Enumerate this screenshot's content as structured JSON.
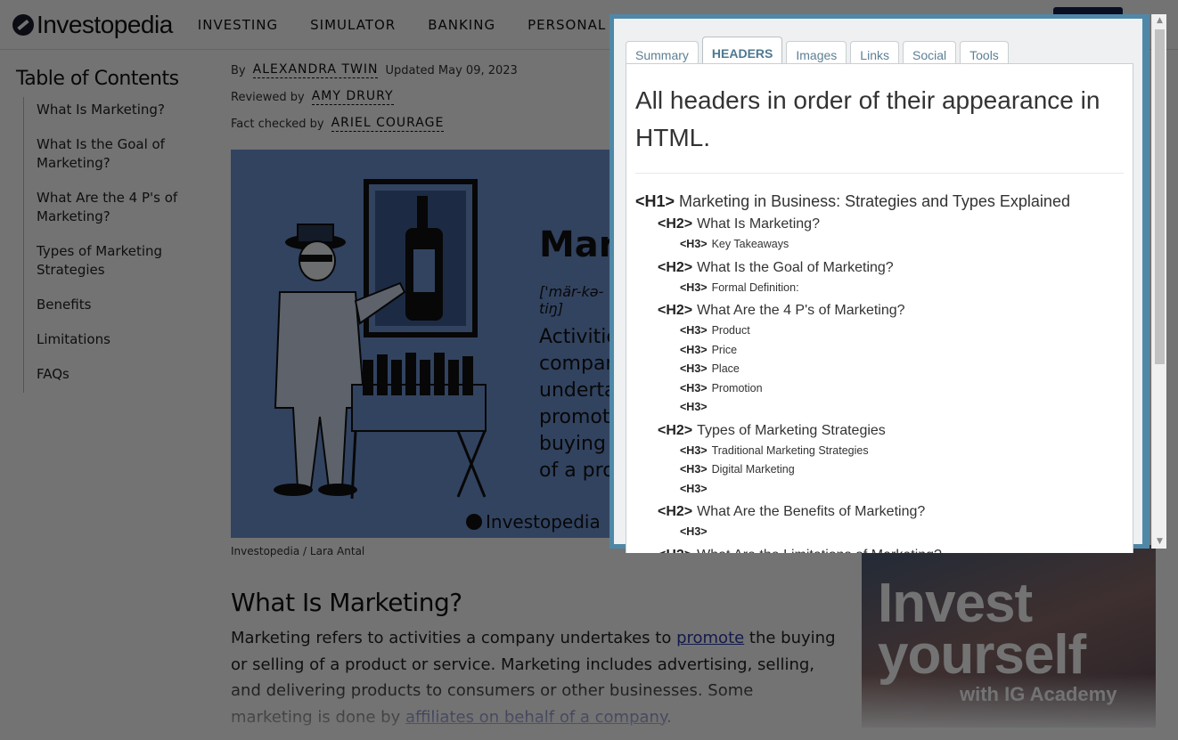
{
  "site": {
    "logo_text": "Investopedia",
    "nav": [
      "INVESTING",
      "SIMULATOR",
      "BANKING",
      "PERSONAL FINANCE"
    ]
  },
  "toc": {
    "title": "Table of Contents",
    "items": [
      "What Is Marketing?",
      "What Is the Goal of Marketing?",
      "What Are the 4 P's of Marketing?",
      "Types of Marketing Strategies",
      "Benefits",
      "Limitations",
      "FAQs"
    ]
  },
  "byline": {
    "by_label": "By",
    "author": "ALEXANDRA TWIN",
    "updated": "Updated May 09, 2023",
    "reviewed_label": "Reviewed by",
    "reviewer": "AMY DRURY",
    "factcheck_label": "Fact checked by",
    "factchecker": "ARIEL COURAGE"
  },
  "hero": {
    "title": "Marketing",
    "pronunciation": "['mär-kə-tiŋ]",
    "definition": "Activities a company undertakes to promote the buying or selling of a product",
    "brand": "Investopedia",
    "caption": "Investopedia / Lara Antal",
    "bg_color": "#6f95d6"
  },
  "article": {
    "heading": "What Is Marketing?",
    "p_before_link": "Marketing refers to activities a company undertakes to ",
    "link1": "promote",
    "p_after_link": " the buying or selling of a product or service. Marketing includes advertising, selling, and delivering products to consumers or other businesses. Some marketing is done by ",
    "link2": "affiliates on behalf of a company",
    "p_end": "."
  },
  "ad": {
    "line1": "Invest",
    "line2": "yourself",
    "line3": "with IG Academy"
  },
  "popup": {
    "tabs": [
      {
        "label": "Summary",
        "active": false
      },
      {
        "label": "HEADERS",
        "active": true
      },
      {
        "label": "Images",
        "active": false
      },
      {
        "label": "Links",
        "active": false
      },
      {
        "label": "Social",
        "active": false
      },
      {
        "label": "Tools",
        "active": false
      }
    ],
    "title": "All headers in order of their appearance in HTML.",
    "headers": [
      {
        "level": 1,
        "tag": "<H1>",
        "text": "Marketing in Business: Strategies and Types Explained"
      },
      {
        "level": 2,
        "tag": "<H2>",
        "text": "What Is Marketing?"
      },
      {
        "level": 3,
        "tag": "<H3>",
        "text": "Key Takeaways"
      },
      {
        "level": 2,
        "tag": "<H2>",
        "text": "What Is the Goal of Marketing?"
      },
      {
        "level": 3,
        "tag": "<H3>",
        "text": "Formal Definition:"
      },
      {
        "level": 2,
        "tag": "<H2>",
        "text": "What Are the 4 P's of Marketing?"
      },
      {
        "level": 3,
        "tag": "<H3>",
        "text": "Product"
      },
      {
        "level": 3,
        "tag": "<H3>",
        "text": "Price"
      },
      {
        "level": 3,
        "tag": "<H3>",
        "text": "Place"
      },
      {
        "level": 3,
        "tag": "<H3>",
        "text": "Promotion"
      },
      {
        "level": 3,
        "tag": "<H3>",
        "text": ""
      },
      {
        "level": 2,
        "tag": "<H2>",
        "text": "Types of Marketing Strategies"
      },
      {
        "level": 3,
        "tag": "<H3>",
        "text": "Traditional Marketing Strategies"
      },
      {
        "level": 3,
        "tag": "<H3>",
        "text": "Digital Marketing"
      },
      {
        "level": 3,
        "tag": "<H3>",
        "text": ""
      },
      {
        "level": 2,
        "tag": "<H2>",
        "text": "What Are the Benefits of Marketing?"
      },
      {
        "level": 3,
        "tag": "<H3>",
        "text": ""
      },
      {
        "level": 2,
        "tag": "<H2>",
        "text": "What Are the Limitations of Marketing?"
      }
    ],
    "accent_color": "#4f88a7",
    "tab_underline_color": "#b387d2"
  },
  "scrollbar": {
    "up_icon": "▲",
    "down_icon": "▼",
    "scroll_position_fraction": 0.0
  }
}
